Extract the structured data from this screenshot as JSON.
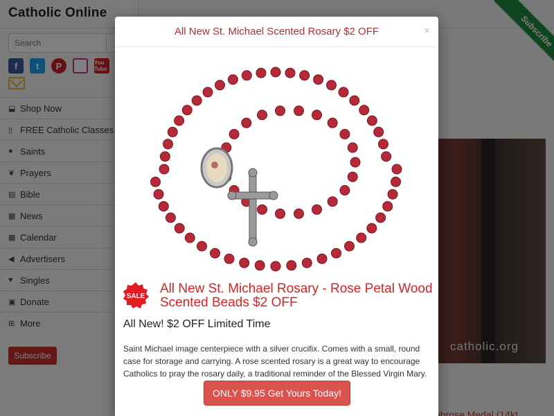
{
  "site": {
    "brand": "Catholic Online"
  },
  "search": {
    "placeholder": "Search"
  },
  "socials": [
    {
      "icon": "facebook-icon",
      "glyph": "f"
    },
    {
      "icon": "twitter-icon",
      "glyph": "t"
    },
    {
      "icon": "pinterest-icon",
      "glyph": "P"
    },
    {
      "icon": "instagram-icon",
      "glyph": ""
    },
    {
      "icon": "youtube-icon",
      "glyph": "You Tube"
    }
  ],
  "nav": [
    {
      "label": "Shop Now",
      "icon": "cart-icon",
      "glyph": "⬓"
    },
    {
      "label": "FREE Catholic Classes",
      "icon": "book-icon",
      "glyph": "▯"
    },
    {
      "label": "Saints",
      "icon": "users-icon",
      "glyph": "●"
    },
    {
      "label": "Prayers",
      "icon": "leaf-icon",
      "glyph": "❦"
    },
    {
      "label": "Bible",
      "icon": "bible-icon",
      "glyph": "▤"
    },
    {
      "label": "News",
      "icon": "newspaper-icon",
      "glyph": "▦"
    },
    {
      "label": "Calendar",
      "icon": "calendar-icon",
      "glyph": "▦"
    },
    {
      "label": "Advertisers",
      "icon": "bullhorn-icon",
      "glyph": "◀"
    },
    {
      "label": "Singles",
      "icon": "heart-icon",
      "glyph": "♥"
    },
    {
      "label": "Donate",
      "icon": "gift-icon",
      "glyph": "▣"
    },
    {
      "label": "More",
      "icon": "plus-square-icon",
      "glyph": "⊞"
    }
  ],
  "sidebar_subscribe": "Subscribe",
  "ribbon": "Subscribe",
  "hero": {
    "watermark": "catholic.org"
  },
  "bottom_link": "nbrose Medal (14kt",
  "modal": {
    "title": "All New St. Michael Scented Rosary $2 OFF",
    "close": "×",
    "sale_badge": "SALE",
    "product_title": "All New St. Michael Rosary - Rose Petal Wood Scented Beads $2 OFF",
    "subline": "All New! $2 OFF Limited Time",
    "description": "Saint Michael image centerpiece with a silver crucifix. Comes with a small, round case for storage and carrying. A rose scented rosary is a great way to encourage Catholics to pray the rosary daily, a traditional reminder of the Blessed Virgin Mary.",
    "cta": "ONLY $9.95 Get Yours Today!"
  },
  "colors": {
    "accent": "#d42426",
    "cta": "#d9534f",
    "ribbon": "#1e8a3c"
  }
}
